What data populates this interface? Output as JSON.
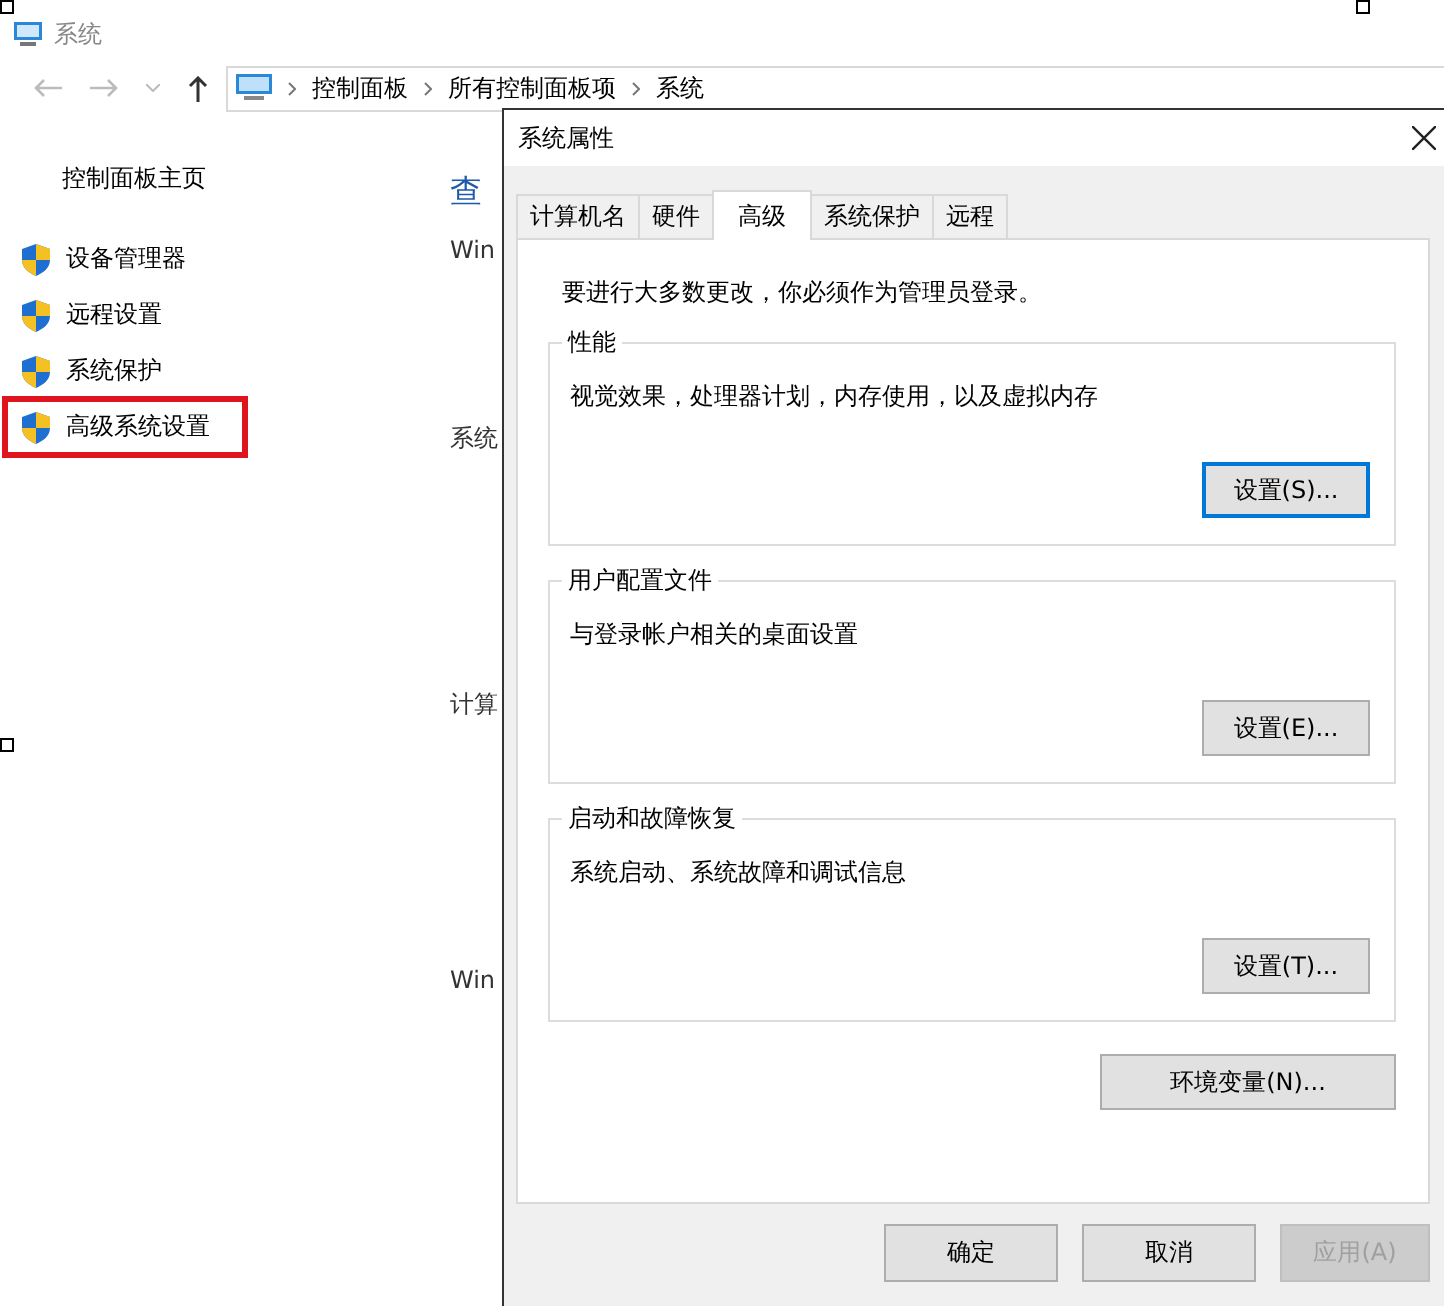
{
  "window": {
    "title": "系统"
  },
  "address_bar": {
    "crumbs": [
      "控制面板",
      "所有控制面板项",
      "系统"
    ]
  },
  "sidebar": {
    "home": "控制面板主页",
    "items": [
      {
        "label": "设备管理器",
        "highlighted": false
      },
      {
        "label": "远程设置",
        "highlighted": false
      },
      {
        "label": "系统保护",
        "highlighted": false
      },
      {
        "label": "高级系统设置",
        "highlighted": true
      }
    ]
  },
  "content": [
    {
      "kind": "heading",
      "text": "查"
    },
    {
      "kind": "section",
      "text": "Win"
    },
    {
      "kind": "section",
      "text": "系统"
    },
    {
      "kind": "section",
      "text": "计算"
    },
    {
      "kind": "section",
      "text": "Win"
    }
  ],
  "dialog": {
    "title": "系统属性",
    "tabs": [
      {
        "label": "计算机名",
        "selected": false
      },
      {
        "label": "硬件",
        "selected": false
      },
      {
        "label": "高级",
        "selected": true
      },
      {
        "label": "系统保护",
        "selected": false
      },
      {
        "label": "远程",
        "selected": false
      }
    ],
    "notice": "要进行大多数更改，你必须作为管理员登录。",
    "groups": [
      {
        "title": "性能",
        "description": "视觉效果，处理器计划，内存使用，以及虚拟内存",
        "button": "设置(S)...",
        "focused": true
      },
      {
        "title": "用户配置文件",
        "description": "与登录帐户相关的桌面设置",
        "button": "设置(E)...",
        "focused": false
      },
      {
        "title": "启动和故障恢复",
        "description": "系统启动、系统故障和调试信息",
        "button": "设置(T)...",
        "focused": false
      }
    ],
    "env_button": "环境变量(N)...",
    "buttons": [
      {
        "label": "确定",
        "disabled": false
      },
      {
        "label": "取消",
        "disabled": false
      },
      {
        "label": "应用(A)",
        "disabled": true
      }
    ]
  }
}
